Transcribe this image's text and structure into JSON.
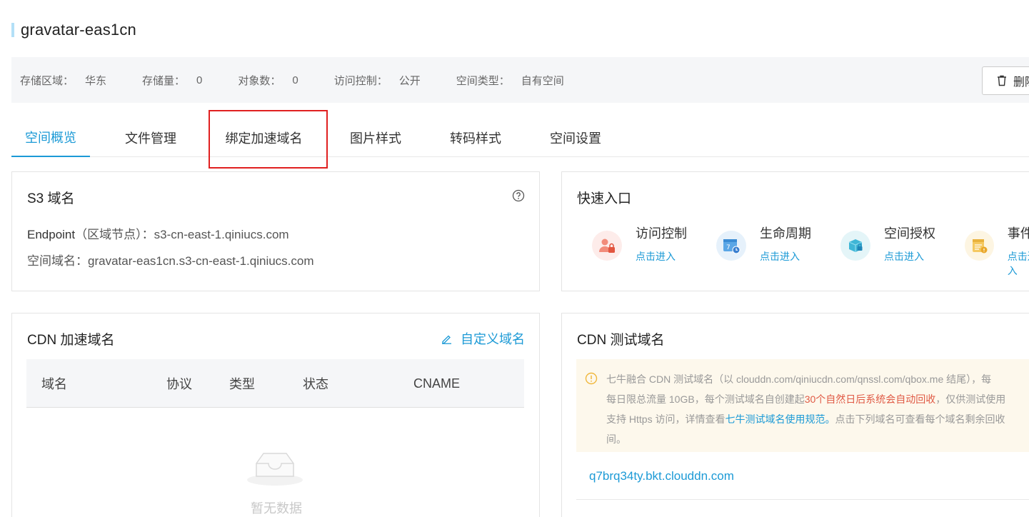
{
  "bucket": {
    "name": "gravatar-eas1cn"
  },
  "info": [
    {
      "label": "存储区域：",
      "value": "华东"
    },
    {
      "label": "存储量：",
      "value": "0"
    },
    {
      "label": "对象数：",
      "value": "0"
    },
    {
      "label": "访问控制：",
      "value": "公开"
    },
    {
      "label": "空间类型：",
      "value": "自有空间"
    }
  ],
  "toolbar": {
    "delete_label": "删除"
  },
  "tabs": [
    {
      "label": "空间概览"
    },
    {
      "label": "文件管理"
    },
    {
      "label": "绑定加速域名"
    },
    {
      "label": "图片样式"
    },
    {
      "label": "转码样式"
    },
    {
      "label": "空间设置"
    }
  ],
  "s3": {
    "title": "S3 域名",
    "endpoint_label": "Endpoint",
    "endpoint_suffix": "（区域节点）：",
    "endpoint_value": "s3-cn-east-1.qiniucs.com",
    "domain_label": "空间域名：",
    "domain_value": "gravatar-eas1cn.s3-cn-east-1.qiniucs.com"
  },
  "quick": {
    "title": "快速入口",
    "items": [
      {
        "name": "访问控制",
        "link": "点击进入",
        "icon": "access-control-icon"
      },
      {
        "name": "生命周期",
        "link": "点击进入",
        "icon": "lifecycle-icon"
      },
      {
        "name": "空间授权",
        "link": "点击进入",
        "icon": "space-auth-icon"
      },
      {
        "name": "事件",
        "link": "点击进入",
        "icon": "event-icon"
      }
    ]
  },
  "cdn": {
    "title": "CDN 加速域名",
    "custom_label": "自定义域名",
    "columns": [
      "域名",
      "协议",
      "类型",
      "状态",
      "CNAME"
    ],
    "empty_text": "暂无数据"
  },
  "test": {
    "title": "CDN 测试域名",
    "notice_line1": "七牛融合 CDN 测试域名（以 clouddn.com/qiniucdn.com/qnssl.com/qbox.me 结尾），每",
    "notice_line2_a": "每日限总流量 10GB，每个测试域名自创建起",
    "notice_line2_red": "30个自然日后系统会自动回收",
    "notice_line2_b": "，仅供测试使用",
    "notice_line3_a": "支持 Https 访问，详情查看",
    "notice_line3_link": "七牛测试域名使用规范。",
    "notice_line3_b": "点击下列域名可查看每个域名剩余回收",
    "notice_line4": "间。",
    "domain": "q7brq34ty.bkt.clouddn.com"
  },
  "colors": {
    "accent": "#1c9ad6",
    "highlight": "#e02020"
  }
}
